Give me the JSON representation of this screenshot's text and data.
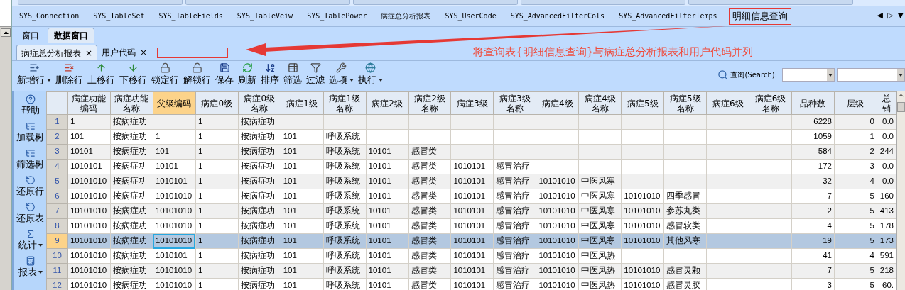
{
  "doc_tabs": [
    {
      "label": "SYS_Connection",
      "highlighted": false
    },
    {
      "label": "SYS_TableSet",
      "highlighted": false
    },
    {
      "label": "SYS_TableFields",
      "highlighted": false
    },
    {
      "label": "SYS_TableVeiw",
      "highlighted": false
    },
    {
      "label": "SYS_TablePower",
      "highlighted": false
    },
    {
      "label": "病症总分析报表",
      "highlighted": false
    },
    {
      "label": "SYS_UserCode",
      "highlighted": false
    },
    {
      "label": "SYS_AdvancedFilterCols",
      "highlighted": false
    },
    {
      "label": "SYS_AdvancedFilterTemps",
      "highlighted": false
    },
    {
      "label": "明细信息查询",
      "highlighted": true
    }
  ],
  "tab_nav": [
    "◀",
    "▷",
    "▼"
  ],
  "window_tabs": [
    {
      "label": "窗口",
      "selected": false
    },
    {
      "label": "数据窗口",
      "selected": true
    }
  ],
  "sub_tabs": [
    {
      "label": "病症总分析报表",
      "close": "×",
      "selected": true
    },
    {
      "label": "用户代码",
      "close": "×",
      "selected": false
    }
  ],
  "annotation": {
    "text": "将查询表{明细信息查询}与病症总分析报表和用户代码并列"
  },
  "toolbar": [
    {
      "label": "新增行",
      "has_menu": true
    },
    {
      "label": "删除行",
      "has_menu": false
    },
    {
      "label": "上移行",
      "has_menu": false
    },
    {
      "label": "下移行",
      "has_menu": false
    },
    {
      "label": "锁定行",
      "has_menu": false
    },
    {
      "label": "解锁行",
      "has_menu": false
    },
    {
      "label": "保存",
      "has_menu": false
    },
    {
      "label": "刷新",
      "has_menu": false
    },
    {
      "label": "排序",
      "has_menu": false
    },
    {
      "label": "筛选",
      "has_menu": false
    },
    {
      "label": "过滤",
      "has_menu": false
    },
    {
      "label": "选项",
      "has_menu": true
    },
    {
      "label": "执行",
      "has_menu": true
    }
  ],
  "search": {
    "label": "查询(Search):"
  },
  "sidebar": [
    {
      "label": "帮助",
      "has_menu": false
    },
    {
      "label": "加载树",
      "has_menu": false
    },
    {
      "label": "筛选树",
      "has_menu": false
    },
    {
      "label": "还原行",
      "has_menu": false
    },
    {
      "label": "还原表",
      "has_menu": false
    },
    {
      "label": "统计",
      "has_menu": true
    },
    {
      "label": "报表",
      "has_menu": true
    }
  ],
  "table": {
    "columns": [
      {
        "label": "病症功能编码",
        "kind": "text",
        "selected": false
      },
      {
        "label": "病症功能名称",
        "kind": "text",
        "selected": false
      },
      {
        "label": "父级编码",
        "kind": "text",
        "selected": true
      },
      {
        "label": "病症0级",
        "kind": "text",
        "selected": false
      },
      {
        "label": "病症0级名称",
        "kind": "text",
        "selected": false
      },
      {
        "label": "病症1级",
        "kind": "text",
        "selected": false
      },
      {
        "label": "病症1级名称",
        "kind": "text",
        "selected": false
      },
      {
        "label": "病症2级",
        "kind": "text",
        "selected": false
      },
      {
        "label": "病症2级名称",
        "kind": "text",
        "selected": false
      },
      {
        "label": "病症3级",
        "kind": "text",
        "selected": false
      },
      {
        "label": "病症3级名称",
        "kind": "text",
        "selected": false
      },
      {
        "label": "病症4级",
        "kind": "text",
        "selected": false
      },
      {
        "label": "病症4级名称",
        "kind": "text",
        "selected": false
      },
      {
        "label": "病症5级",
        "kind": "text",
        "selected": false
      },
      {
        "label": "病症5级名称",
        "kind": "text",
        "selected": false
      },
      {
        "label": "病症6级",
        "kind": "text",
        "selected": false
      },
      {
        "label": "病症6级名称",
        "kind": "text",
        "selected": false
      },
      {
        "label": "品种数",
        "kind": "number",
        "selected": false
      },
      {
        "label": "层级",
        "kind": "number",
        "selected": false
      },
      {
        "label": "总销",
        "kind": "number",
        "selected": false
      }
    ],
    "rows": [
      {
        "number": "1",
        "selected": false,
        "cells": [
          "1",
          "按病症功",
          "",
          "1",
          "按病症功",
          "",
          "",
          "",
          "",
          "",
          "",
          "",
          "",
          "",
          "",
          "",
          "",
          "6228",
          "0",
          "0.0"
        ]
      },
      {
        "number": "2",
        "selected": false,
        "cells": [
          "101",
          "按病症功",
          "1",
          "1",
          "按病症功",
          "101",
          "呼吸系统",
          "",
          "",
          "",
          "",
          "",
          "",
          "",
          "",
          "",
          "",
          "1059",
          "1",
          "0.0"
        ]
      },
      {
        "number": "3",
        "selected": false,
        "cells": [
          "10101",
          "按病症功",
          "101",
          "1",
          "按病症功",
          "101",
          "呼吸系统",
          "10101",
          "感冒类",
          "",
          "",
          "",
          "",
          "",
          "",
          "",
          "",
          "584",
          "2",
          "244"
        ]
      },
      {
        "number": "4",
        "selected": false,
        "cells": [
          "1010101",
          "按病症功",
          "10101",
          "1",
          "按病症功",
          "101",
          "呼吸系统",
          "10101",
          "感冒类",
          "1010101",
          "感冒治疗",
          "",
          "",
          "",
          "",
          "",
          "",
          "172",
          "3",
          "0.0"
        ]
      },
      {
        "number": "5",
        "selected": false,
        "cells": [
          "10101010",
          "按病症功",
          "1010101",
          "1",
          "按病症功",
          "101",
          "呼吸系统",
          "10101",
          "感冒类",
          "1010101",
          "感冒治疗",
          "10101010",
          "中医风寒",
          "",
          "",
          "",
          "",
          "32",
          "4",
          "0.0"
        ]
      },
      {
        "number": "6",
        "selected": false,
        "cells": [
          "10101010",
          "按病症功",
          "10101010",
          "1",
          "按病症功",
          "101",
          "呼吸系统",
          "10101",
          "感冒类",
          "1010101",
          "感冒治疗",
          "10101010",
          "中医风寒",
          "10101010",
          "四季感冒",
          "",
          "",
          "7",
          "5",
          "160"
        ]
      },
      {
        "number": "7",
        "selected": false,
        "cells": [
          "10101010",
          "按病症功",
          "10101010",
          "1",
          "按病症功",
          "101",
          "呼吸系统",
          "10101",
          "感冒类",
          "1010101",
          "感冒治疗",
          "10101010",
          "中医风寒",
          "10101010",
          "参苏丸类",
          "",
          "",
          "2",
          "5",
          "413"
        ]
      },
      {
        "number": "8",
        "selected": false,
        "cells": [
          "10101010",
          "按病症功",
          "10101010",
          "1",
          "按病症功",
          "101",
          "呼吸系统",
          "10101",
          "感冒类",
          "1010101",
          "感冒治疗",
          "10101010",
          "中医风寒",
          "10101010",
          "感冒软类",
          "",
          "",
          "4",
          "5",
          "178"
        ]
      },
      {
        "number": "9",
        "selected": true,
        "cells": [
          "10101010",
          "按病症功",
          "10101010",
          "1",
          "按病症功",
          "101",
          "呼吸系统",
          "10101",
          "感冒类",
          "1010101",
          "感冒治疗",
          "10101010",
          "中医风寒",
          "10101010",
          "其他风寒",
          "",
          "",
          "19",
          "5",
          "173"
        ]
      },
      {
        "number": "10",
        "selected": false,
        "cells": [
          "10101010",
          "按病症功",
          "1010101",
          "1",
          "按病症功",
          "101",
          "呼吸系统",
          "10101",
          "感冒类",
          "1010101",
          "感冒治疗",
          "10101010",
          "中医风热",
          "",
          "",
          "",
          "",
          "41",
          "4",
          "591"
        ]
      },
      {
        "number": "11",
        "selected": false,
        "cells": [
          "10101010",
          "按病症功",
          "10101010",
          "1",
          "按病症功",
          "101",
          "呼吸系统",
          "10101",
          "感冒类",
          "1010101",
          "感冒治疗",
          "10101010",
          "中医风热",
          "10101010",
          "感冒灵颗",
          "",
          "",
          "7",
          "5",
          "218"
        ]
      },
      {
        "number": "12",
        "selected": false,
        "cells": [
          "10101010",
          "按病症功",
          "10101010",
          "1",
          "按病症功",
          "101",
          "呼吸系统",
          "10101",
          "感冒类",
          "1010101",
          "感冒治疗",
          "10101010",
          "中医风热",
          "10101010",
          "感冒灵胶",
          "",
          "",
          "3",
          "5",
          "60."
        ]
      }
    ]
  }
}
